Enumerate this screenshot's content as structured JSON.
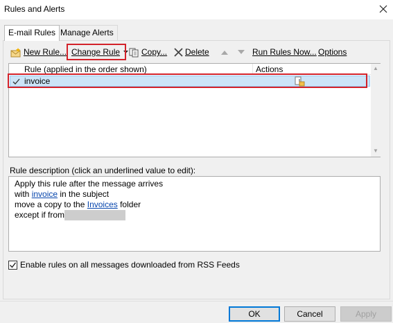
{
  "window": {
    "title": "Rules and Alerts"
  },
  "tabs": [
    {
      "label": "E-mail Rules",
      "active": true
    },
    {
      "label": "Manage Alerts",
      "active": false
    }
  ],
  "toolbar": {
    "new_rule": "New Rule...",
    "change_rule": "Change Rule",
    "copy": "Copy...",
    "delete": "Delete",
    "run_rules_now": "Run Rules Now...",
    "options": "Options"
  },
  "rules_list": {
    "columns": [
      "Rule (applied in the order shown)",
      "Actions"
    ],
    "rows": [
      {
        "name": "invoice",
        "checked": true,
        "selected": true,
        "action_icon": "move-copy-icon"
      }
    ]
  },
  "description": {
    "label": "Rule description (click an underlined value to edit):",
    "line1": "Apply this rule after the message arrives",
    "line2_pre": "with ",
    "line2_link": "invoice",
    "line2_post": " in the subject",
    "line3_pre": "move a copy to the ",
    "line3_link": "Invoices",
    "line3_post": " folder",
    "line4_pre": "except if from"
  },
  "rss_option": {
    "label": "Enable rules on all messages downloaded from RSS Feeds",
    "checked": true
  },
  "buttons": {
    "ok": "OK",
    "cancel": "Cancel",
    "apply": "Apply"
  },
  "colors": {
    "highlight": "#d3222a",
    "selection": "#cce4f7",
    "link": "#0645ad"
  }
}
